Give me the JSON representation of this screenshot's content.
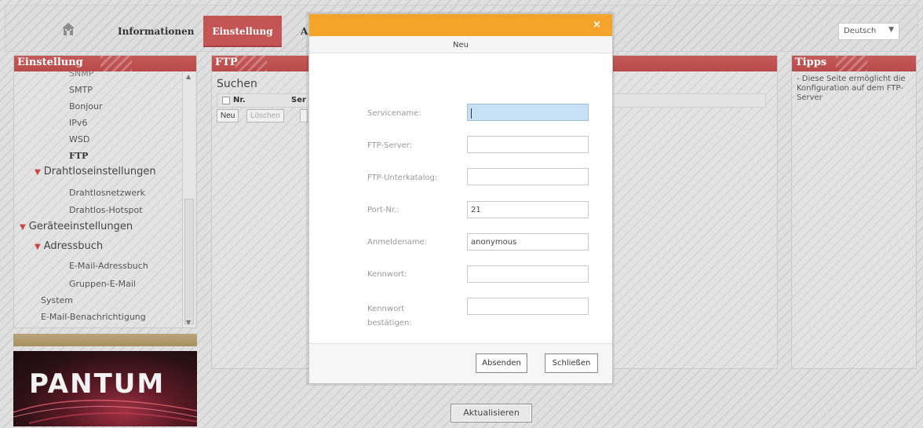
{
  "header": {
    "nav_info": "Informationen",
    "nav_active": "Einstellung",
    "nav_partial": "A",
    "language": "Deutsch",
    "home_icon": "home-icon"
  },
  "left_panel": {
    "title": "Einstellung",
    "items": [
      {
        "label": "SNMP"
      },
      {
        "label": "SMTP"
      },
      {
        "label": "Bonjour"
      },
      {
        "label": "IPv6"
      },
      {
        "label": "WSD"
      },
      {
        "label": "FTP"
      },
      {
        "label": "Drahtloseinstellungen"
      },
      {
        "label": "Drahtlosnetzwerk"
      },
      {
        "label": "Drahtlos-Hotspot"
      },
      {
        "label": "Geräteeinstellungen"
      },
      {
        "label": "Adressbuch"
      },
      {
        "label": "E-Mail-Adressbuch"
      },
      {
        "label": "Gruppen-E-Mail"
      },
      {
        "label": "System"
      },
      {
        "label": "E-Mail-Benachrichtigung"
      }
    ]
  },
  "logo": {
    "text": "PANTUM"
  },
  "ftp_panel": {
    "title": "FTP",
    "search_label": "Suchen",
    "col_nr": "Nr.",
    "col_serv": "Ser",
    "btn_new": "Neu",
    "btn_delete": "Löschen"
  },
  "tipps_panel": {
    "title": "Tipps",
    "text": "- Diese Seite ermöglicht die Konfiguration auf dem FTP-Server"
  },
  "refresh_button": "Aktualisieren",
  "modal": {
    "title": "Neu",
    "close_symbol": "×",
    "fields": [
      {
        "label": "Servicename:",
        "value": ""
      },
      {
        "label": "FTP-Server:",
        "value": ""
      },
      {
        "label": "FTP-Unterkatalog:",
        "value": ""
      },
      {
        "label": "Port-Nr.:",
        "value": "21"
      },
      {
        "label": "Anmeldename:",
        "value": "anonymous"
      },
      {
        "label": "Kennwort:",
        "value": ""
      },
      {
        "label": "Kennwort bestätigen:",
        "value": ""
      }
    ],
    "submit": "Absenden",
    "close": "Schließen"
  }
}
